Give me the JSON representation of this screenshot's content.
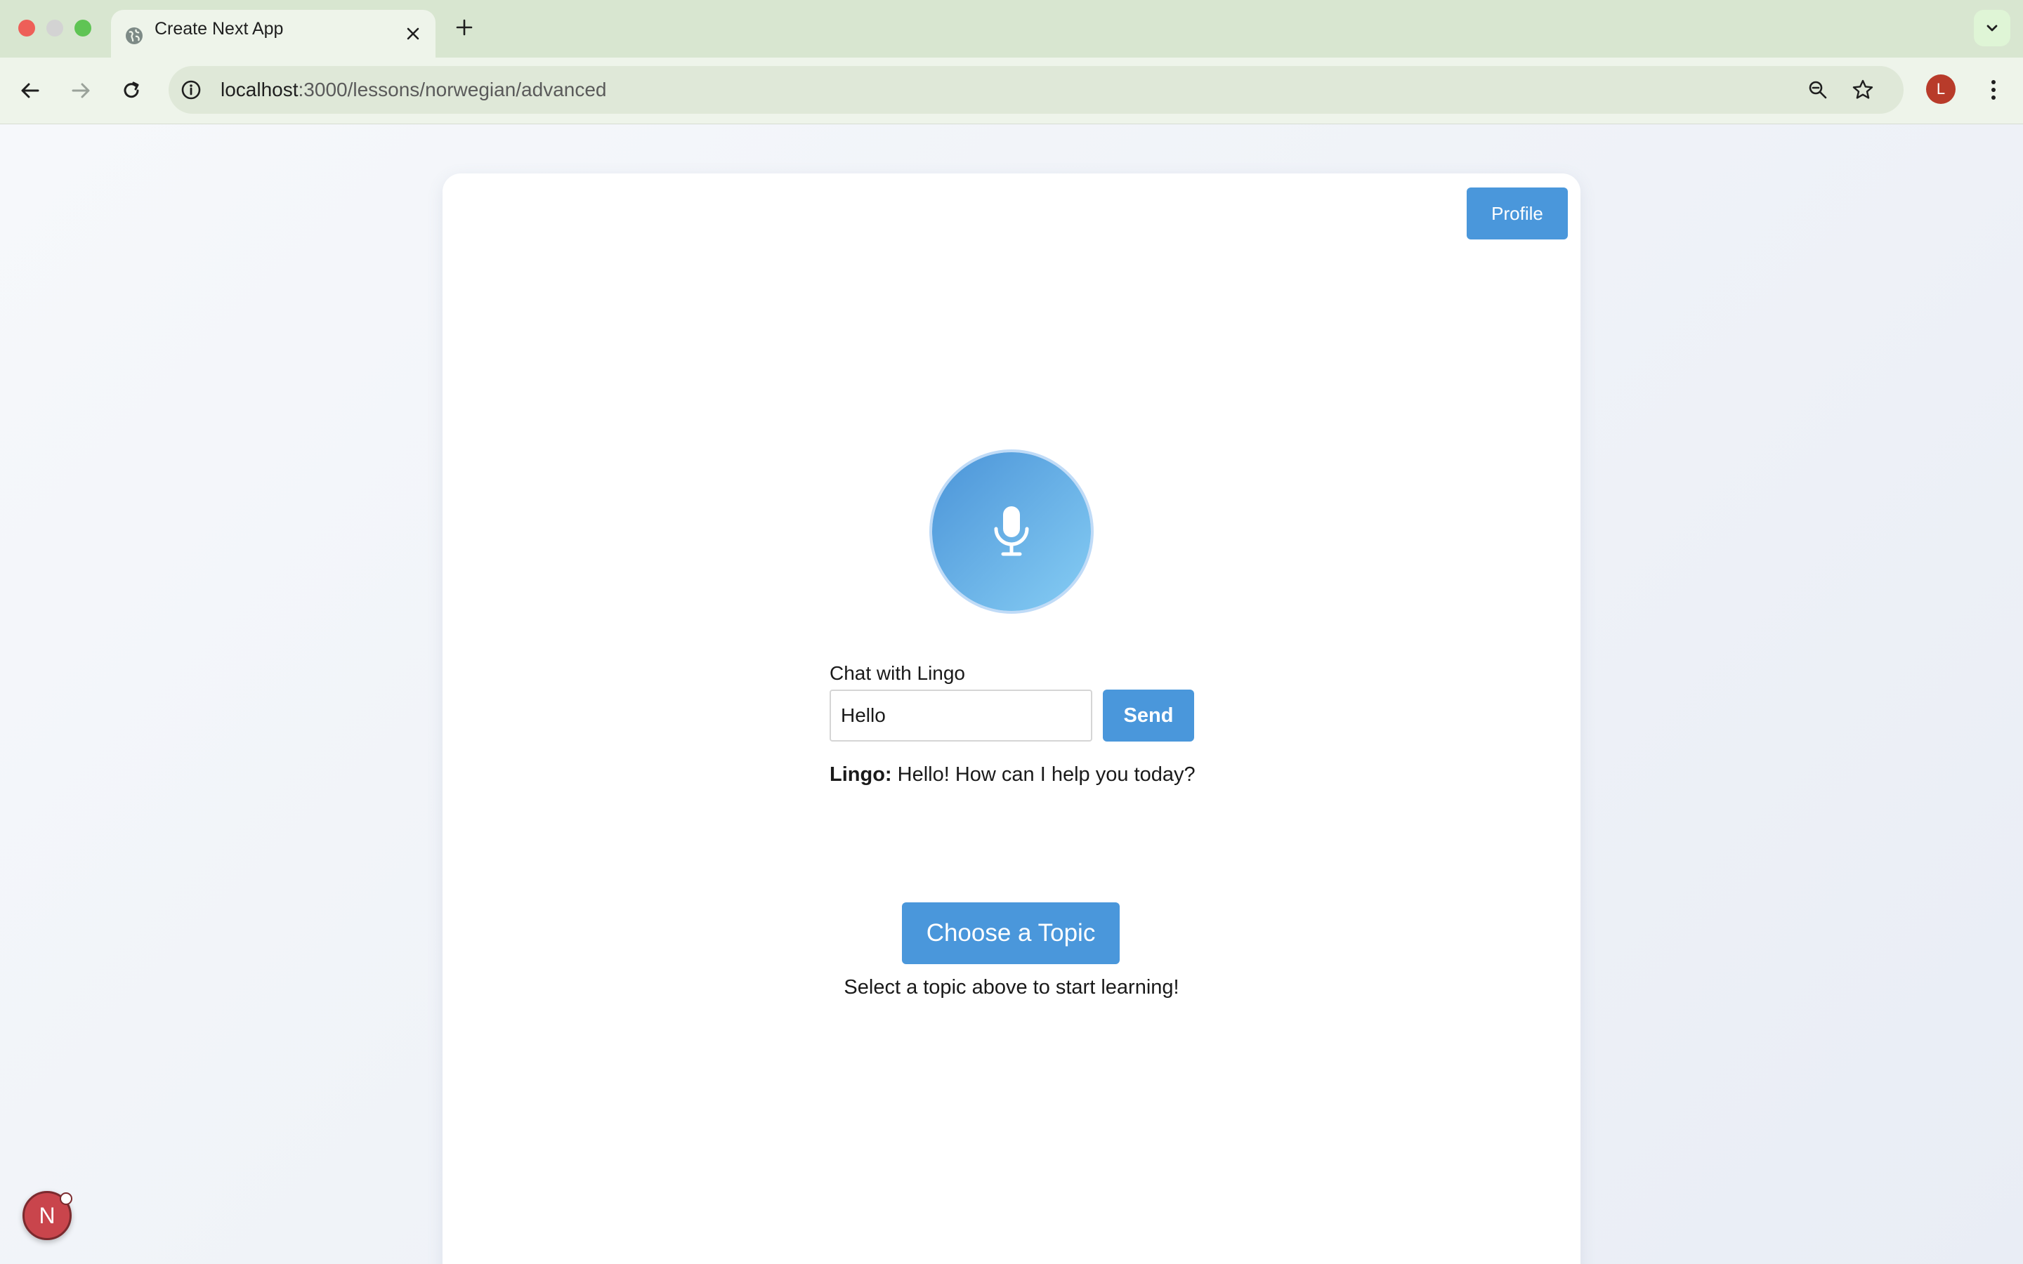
{
  "browser": {
    "tab_title": "Create Next App",
    "url_host": "localhost",
    "url_path": ":3000/lessons/norwegian/advanced",
    "profile_initial": "L"
  },
  "page": {
    "profile_button": "Profile",
    "chat_label": "Chat with Lingo",
    "chat_input_value": "Hello",
    "send_button": "Send",
    "reply_speaker": "Lingo:",
    "reply_text": " Hello! How can I help you today?",
    "topic_button": "Choose a Topic",
    "hint": "Select a topic above to start learning!",
    "dev_badge": "N"
  },
  "colors": {
    "accent": "#4a97db",
    "mic_gradient_start": "#4b94d8",
    "mic_gradient_end": "#86cdf4",
    "chrome_tabbar": "#d8e6d0",
    "chrome_toolbar": "#eef4ea",
    "avatar": "#b83b2a",
    "dev_badge": "#c9454c"
  },
  "icons": {
    "tab": "globe-icon",
    "mic": "microphone-icon",
    "zoom": "zoom-icon",
    "bookmark": "star-icon"
  }
}
